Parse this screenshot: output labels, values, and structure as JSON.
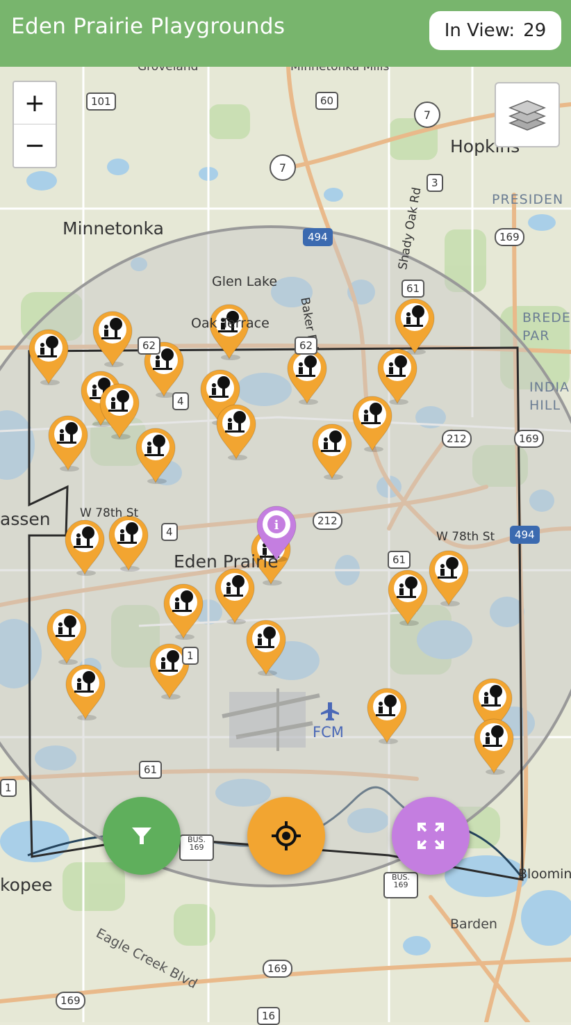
{
  "header": {
    "title": "Eden Prairie Playgrounds",
    "count_label": "In View:",
    "count_value": "29"
  },
  "map": {
    "zoom_in": "+",
    "zoom_out": "−",
    "place_labels": {
      "minnetonka": "Minnetonka",
      "hopkins": "Hopkins",
      "glen_lake": "Glen Lake",
      "oak_terrace": "Oak Terrace",
      "eden_prairie": "Eden Prairie",
      "chanhassen": "assen",
      "shakopee": "kopee",
      "presidents": "PRESIDEN",
      "bredesen": "BREDE\nPAR",
      "indian_hills": "INDIA\nHILL",
      "baker_rd": "Baker Rd",
      "shady_oak_rd": "Shady Oak Rd",
      "w78th_west": "W 78th St",
      "w78th_east": "W 78th St",
      "fcm": "FCM",
      "eagle_creek": "Eagle Creek Blvd",
      "barden": "Barden",
      "bloomington": "Bloomin",
      "minnetonka_mills": "Minnetonka Mills",
      "groveland": "Groveland"
    },
    "shields": [
      "101",
      "60",
      "7",
      "7",
      "3",
      "494",
      "169",
      "61",
      "62",
      "62",
      "4",
      "212",
      "212",
      "169",
      "4",
      "61",
      "494",
      "1",
      "61",
      "BUS. 169",
      "BUS. 169",
      "169",
      "169",
      "16",
      "1"
    ],
    "playground_count": 29,
    "info_marker_color": "#c47ee0",
    "playground_marker_color": "#f2a531"
  },
  "buttons": {
    "filter_color": "#5faf5c",
    "locate_color": "#f2a531",
    "fit_color": "#c47ee0"
  },
  "icons": [
    "zoom-plus-icon",
    "zoom-minus-icon",
    "layers-icon",
    "filter-icon",
    "crosshair-icon",
    "expand-icon",
    "playground-marker-icon",
    "info-marker-icon"
  ]
}
